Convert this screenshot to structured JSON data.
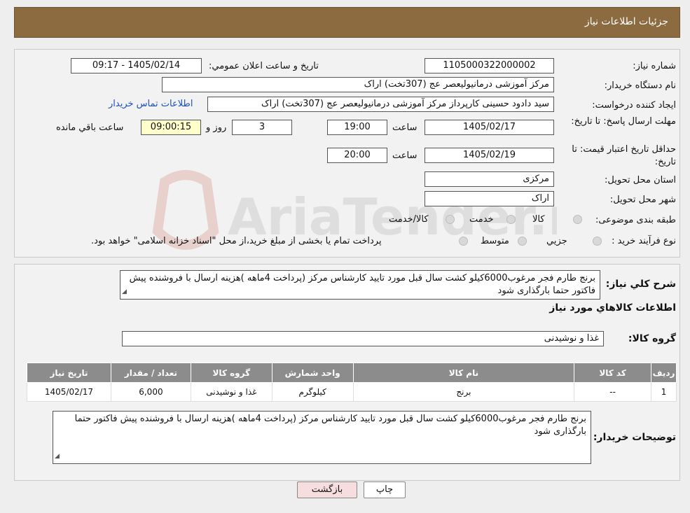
{
  "header": {
    "title": "جزئیات اطلاعات نیاز"
  },
  "form": {
    "need_number_label": "شماره نیاز:",
    "need_number": "1105000322000002",
    "announce_label": "تاریخ و ساعت اعلان عمومي:",
    "announce_value": "1405/02/14 - 09:17",
    "buyer_label": "نام دستگاه خریدار:",
    "buyer_value": "مرکز آموزشی درمانیولیعصر عج (307تخت) اراک",
    "creator_label": "ایجاد کننده درخواست:",
    "creator_value": "سید دادود حسینی کارپرداز مرکز آموزشی درمانیولیعصر عج (307تخت) اراک",
    "contact_link": "اطلاعات تماس خریدار",
    "deadline_label": "مهلت ارسال پاسخ: تا تاریخ:",
    "deadline_date": "1405/02/17",
    "time_label": "ساعت",
    "deadline_time": "19:00",
    "days_value": "3",
    "days_label": "روز و",
    "remaining_time": "09:00:15",
    "remaining_label": "ساعت باقي مانده",
    "validity_label": "حداقل تاریخ اعتبار قیمت: تا تاریخ:",
    "validity_date": "1405/02/19",
    "validity_time": "20:00",
    "province_label": "استان محل تحویل:",
    "province_value": "مرکزی",
    "city_label": "شهر محل تحویل:",
    "city_value": "اراک",
    "category_label": "طبقه بندی موضوعی:",
    "category_options": [
      "کالا",
      "خدمت",
      "کالا/خدمت"
    ],
    "purchase_label": "نوع فرآیند خرید :",
    "purchase_options": [
      "جزیي",
      "متوسط"
    ],
    "purchase_note": "پرداخت تمام یا بخشی از مبلغ خرید،از محل \"اسناد خزانه اسلامی\" خواهد بود."
  },
  "description": {
    "label": "شرح کلي نیاز:",
    "text": "برنج طارم فجر مرغوب6000کیلو کشت سال قبل مورد تایید کارشناس مرکز (پرداخت 4ماهه )هزینه ارسال با فروشنده پیش فاکتور حتما بارگذاری شود",
    "goods_info_title": "اطلاعات کالاهاي مورد نیاز",
    "goods_group_label": "گروه کالا:",
    "goods_group_value": "غذا و نوشیدنی"
  },
  "table": {
    "headers": [
      "ردیف",
      "کد کالا",
      "نام کالا",
      "واحد شمارش",
      "گروه کالا",
      "تعداد / مقدار",
      "تاریخ نیاز"
    ],
    "rows": [
      [
        "1",
        "--",
        "برنج",
        "کیلوگرم",
        "غذا و نوشیدنی",
        "6,000",
        "1405/02/17"
      ]
    ]
  },
  "buyer_notes": {
    "label": "توضیحات خریدار:",
    "text": "برنج طارم فجر مرغوب6000کیلو کشت سال قبل مورد تایید کارشناس مرکز (پرداخت 4ماهه )هزینه ارسال با فروشنده پیش فاکتور حتما بارگذاری شود"
  },
  "buttons": {
    "print": "چاپ",
    "back": "بازگشت"
  },
  "watermark": "AriaTender.neT",
  "colors": {
    "header": "#8b6b3f",
    "table_header": "#8c8c8c",
    "back_button": "#f7dede",
    "link": "#1a4fc4"
  }
}
